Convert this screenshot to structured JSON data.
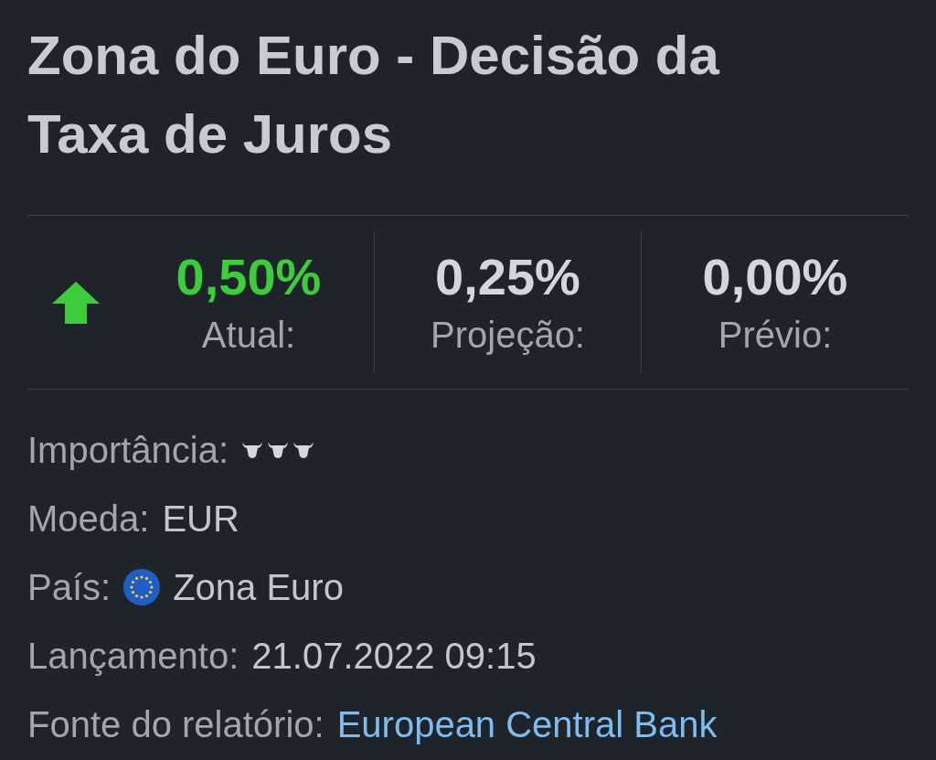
{
  "title": "Zona do Euro - Decisão da Taxa de Juros",
  "stats": [
    {
      "value": "0,50%",
      "label": "Atual:",
      "rising": true
    },
    {
      "value": "0,25%",
      "label": "Projeção:",
      "rising": false
    },
    {
      "value": "0,00%",
      "label": "Prévio:",
      "rising": false
    }
  ],
  "details": [
    {
      "kind": "importance",
      "label": "Importância:",
      "stars": 3
    },
    {
      "kind": "text",
      "label": "Moeda:",
      "value": "EUR"
    },
    {
      "kind": "country",
      "label": "País:",
      "value": "Zona Euro"
    },
    {
      "kind": "text",
      "label": "Lançamento:",
      "value": "21.07.2022 09:15"
    },
    {
      "kind": "link",
      "label": "Fonte do relatório:",
      "value": "European Central Bank"
    }
  ]
}
